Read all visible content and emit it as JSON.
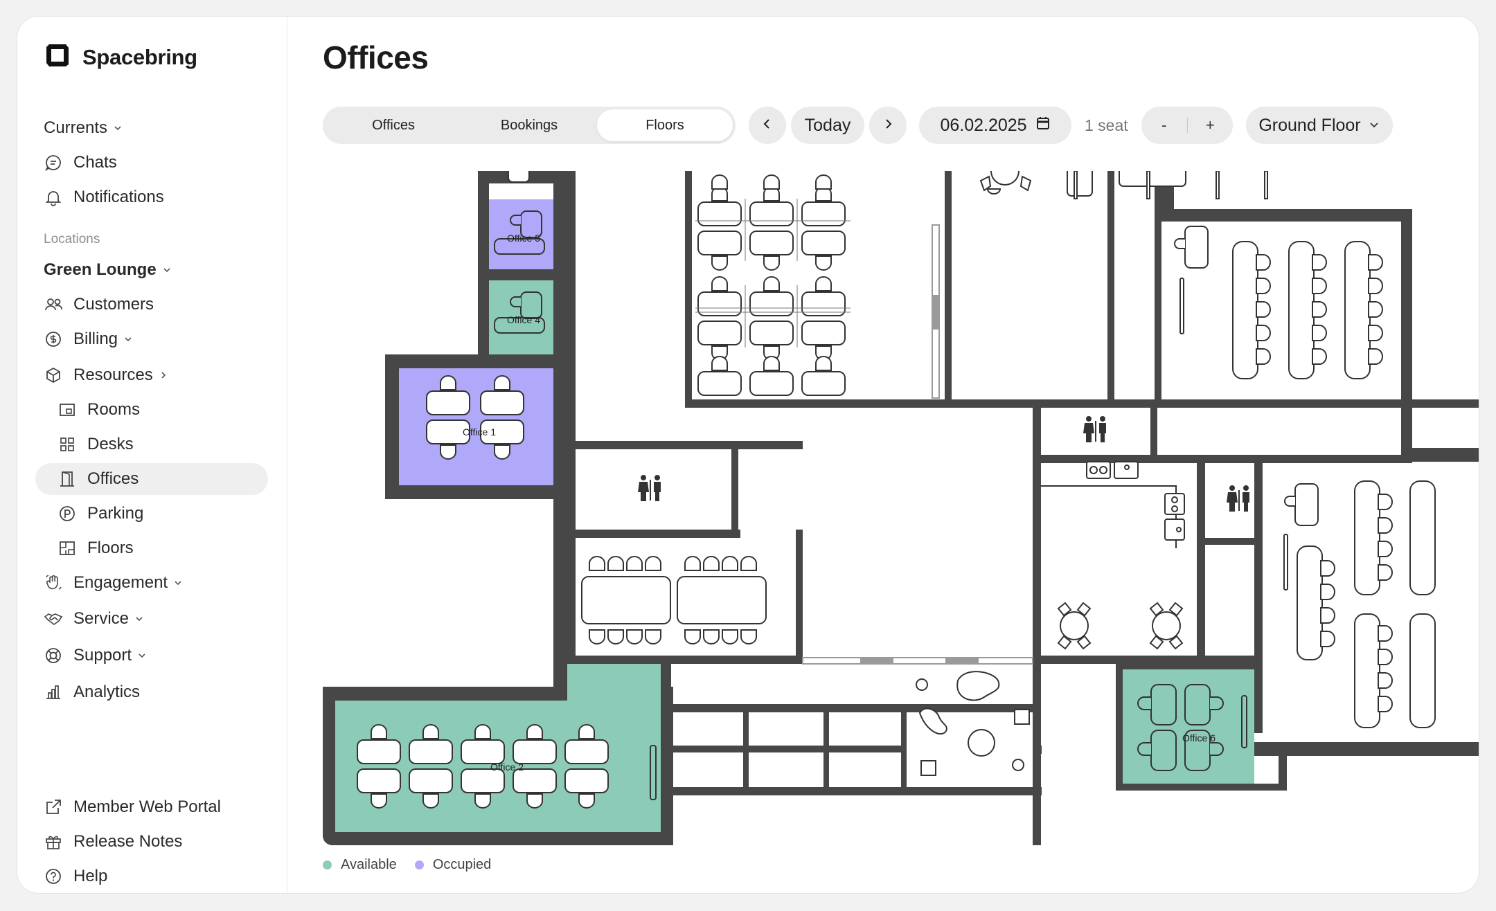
{
  "brand": {
    "name": "Spacebring"
  },
  "sidebar": {
    "top_items": [
      {
        "label": "Currents"
      },
      {
        "label": "Chats"
      },
      {
        "label": "Notifications"
      }
    ],
    "section_label": "Locations",
    "location": "Green Lounge",
    "items": [
      {
        "label": "Customers"
      },
      {
        "label": "Billing"
      },
      {
        "label": "Resources"
      }
    ],
    "resources": [
      {
        "label": "Rooms"
      },
      {
        "label": "Desks"
      },
      {
        "label": "Offices"
      },
      {
        "label": "Parking"
      },
      {
        "label": "Floors"
      }
    ],
    "more_items": [
      {
        "label": "Engagement"
      },
      {
        "label": "Service"
      },
      {
        "label": "Support"
      },
      {
        "label": "Analytics"
      }
    ],
    "bottom_items": [
      {
        "label": "Member Web Portal"
      },
      {
        "label": "Release Notes"
      },
      {
        "label": "Help"
      }
    ]
  },
  "page": {
    "title": "Offices",
    "tabs": [
      {
        "label": "Offices"
      },
      {
        "label": "Bookings"
      },
      {
        "label": "Floors"
      }
    ],
    "active_tab": "Floors",
    "today_label": "Today",
    "date": "06.02.2025",
    "seats": "1 seat",
    "minus": "-",
    "plus": "+",
    "floor": "Ground Floor"
  },
  "floorplan": {
    "offices": [
      {
        "label": "Office 5",
        "status": "Occupied"
      },
      {
        "label": "Office 4",
        "status": "Available"
      },
      {
        "label": "Office 1",
        "status": "Occupied"
      },
      {
        "label": "Office 2",
        "status": "Available"
      },
      {
        "label": "Office 6",
        "status": "Available"
      }
    ]
  },
  "legend": [
    {
      "label": "Available",
      "color": "#8ccbb8"
    },
    {
      "label": "Occupied",
      "color": "#b0a8f8"
    }
  ],
  "colors": {
    "available": "#8ccbb8",
    "occupied": "#b0a8f8",
    "wall": "#474747",
    "active_nav": "#efefef"
  }
}
